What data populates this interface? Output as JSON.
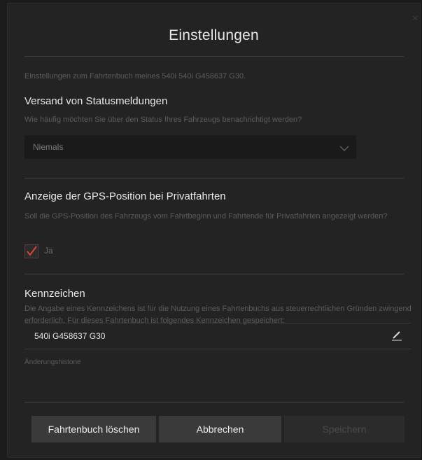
{
  "dialog": {
    "title": "Einstellungen",
    "close_icon": "×",
    "intro": "Einstellungen zum Fahrtenbuch meines 540i 540i G458637 G30."
  },
  "status": {
    "heading": "Versand von Statusmeldungen",
    "description": "Wie häufig möchten Sie über den Status Ihres Fahrzeugs benachrichtigt werden?",
    "selected": "Niemals"
  },
  "gps": {
    "heading": "Anzeige der GPS-Position bei Privatfahrten",
    "description": "Soll die GPS-Position des Fahrzeugs vom Fahrtbeginn und Fahrtende für Privatfahrten angezeigt werden?",
    "checkbox_label": "Ja",
    "checked": true
  },
  "plate": {
    "heading": "Kennzeichen",
    "description": "Die Angabe eines Kennzeichens ist für die Nutzung eines Fahrtenbuchs aus steuerrechtlichen Gründen zwingend erforderlich. Für dieses Fahrtenbuch ist folgendes Kennzeichen gespeichert:",
    "value": "540i G458637 G30",
    "history_link": "Änderungshistorie"
  },
  "buttons": {
    "delete": "Fahrtenbuch löschen",
    "cancel": "Abbrechen",
    "save": "Speichern"
  },
  "colors": {
    "accent_check": "#d2473a",
    "background": "#232323"
  }
}
